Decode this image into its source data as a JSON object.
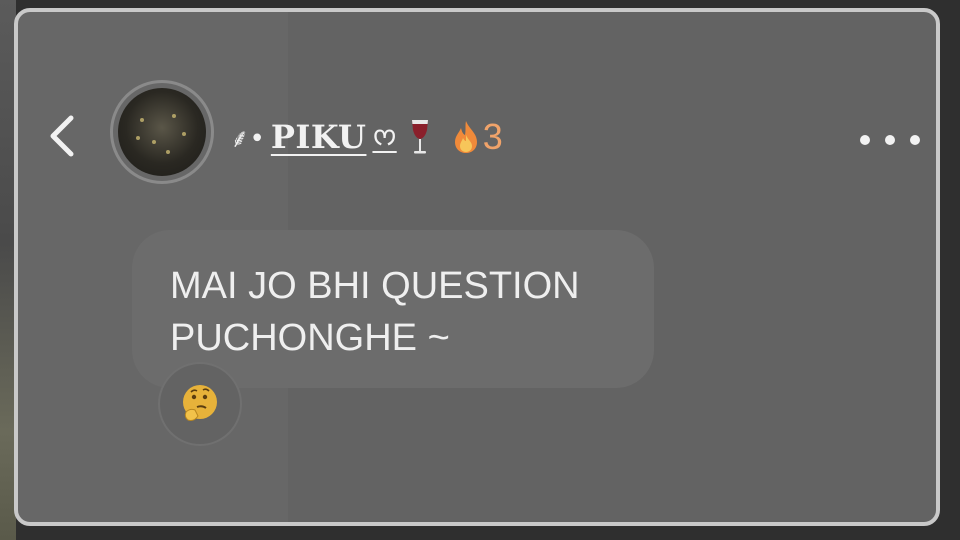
{
  "header": {
    "back_icon": "chevron-left-icon",
    "avatar_icon": "profile-avatar",
    "name_prefix": "⸙•",
    "name_main": "PIKU",
    "name_suffix": "ᰔ",
    "name_emoji_icon": "wine-glass-icon",
    "streak_icon": "fire-icon",
    "streak_count": "3",
    "more_icon": "more-horizontal-icon"
  },
  "messages": [
    {
      "text": "MAI JO BHI QUESTION\nPUCHONGHE ~",
      "reaction_icon": "thinking-face-icon"
    }
  ],
  "colors": {
    "background": "#636363",
    "bubble": "#6c6c6c",
    "text": "#efefef",
    "streak": "#f0a36a",
    "border": "#c9c9c9"
  }
}
